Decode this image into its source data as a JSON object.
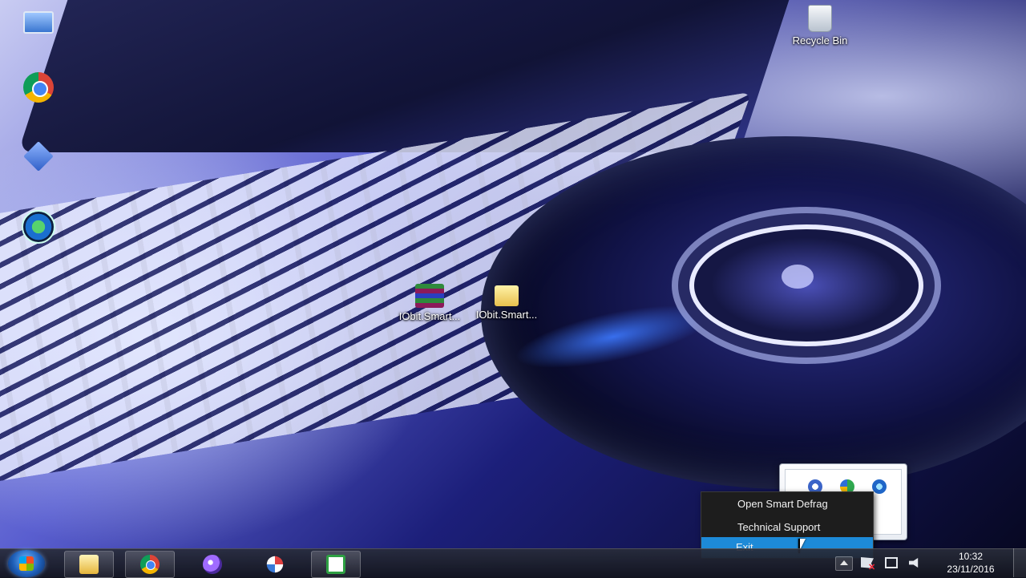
{
  "desktop": {
    "icons": [
      {
        "label": "",
        "icon": "computer-icon"
      },
      {
        "label": "",
        "icon": "chrome-icon"
      },
      {
        "label": "",
        "icon": "tools-icon"
      },
      {
        "label": "",
        "icon": "smart-defrag-icon"
      },
      {
        "label": "IObit.Smart...",
        "icon": "winrar-archive-icon"
      },
      {
        "label": "IObit.Smart...",
        "icon": "folder-icon"
      },
      {
        "label": "Recycle Bin",
        "icon": "recycle-bin-icon"
      }
    ]
  },
  "context_menu": {
    "items": [
      {
        "label": "Open Smart Defrag"
      },
      {
        "label": "Technical Support"
      },
      {
        "label": "Exit",
        "highlighted": true
      }
    ]
  },
  "taskbar": {
    "pinned": [
      {
        "name": "windows-explorer",
        "icon": "folder-icon"
      },
      {
        "name": "google-chrome",
        "icon": "chrome-icon"
      },
      {
        "name": "media-app",
        "icon": "orb-icon"
      },
      {
        "name": "snipping-tool",
        "icon": "scissors-icon"
      },
      {
        "name": "camtasia",
        "icon": "camtasia-icon"
      }
    ],
    "clock": {
      "time": "10:32",
      "date": "23/11/2016"
    }
  },
  "colors": {
    "menu_highlight": "#1d8ad8",
    "menu_background": "#1d1d1d",
    "taskbar": "#1c1f2c"
  }
}
